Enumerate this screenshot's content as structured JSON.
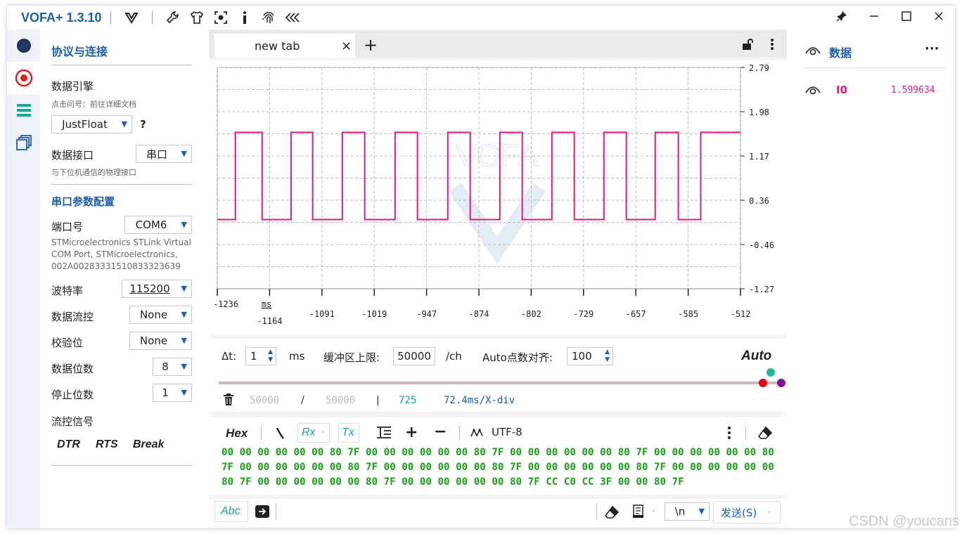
{
  "app": {
    "title": "VOFA+ 1.3.10"
  },
  "left": {
    "section1": "协议与连接",
    "engine_label": "数据引擎",
    "engine_hint": "点击问号：前往详细文档",
    "engine_value": "JustFloat",
    "help": "?",
    "iface_label": "数据接口",
    "iface_value": "串口",
    "iface_hint": "与下位机通信的物理接口",
    "section2": "串口参数配置",
    "port_label": "端口号",
    "port_value": "COM6",
    "port_desc": "STMicroelectronics STLink Virtual COM Port, STMicroelectronics, 002A00283331510833323639",
    "baud_label": "波特率",
    "baud_value": "115200",
    "flow_label": "数据流控",
    "flow_value": "None",
    "parity_label": "校验位",
    "parity_value": "None",
    "databits_label": "数据位数",
    "databits_value": "8",
    "stopbits_label": "停止位数",
    "stopbits_value": "1",
    "signal_label": "流控信号",
    "dtr": "DTR",
    "rts": "RTS",
    "brk": "Break"
  },
  "tab": {
    "label": "new tab",
    "close": "×",
    "add": "+"
  },
  "chart_data": {
    "type": "line",
    "y_ticks": [
      "2.79",
      "1.98",
      "1.17",
      "0.36",
      "-0.46",
      "-1.27"
    ],
    "x_ticks": [
      "-1236",
      "-1164",
      "-1091",
      "-1019",
      "-947",
      "-874",
      "-802",
      "-729",
      "-657",
      "-585",
      "-512"
    ],
    "x_unit": "ms",
    "ylim": [
      -1.27,
      2.79
    ],
    "xlim": [
      -1236,
      -512
    ],
    "series": [
      {
        "name": "I0",
        "color": "#e0177f",
        "low": 0,
        "high": 1.6,
        "edges": [
          -1236,
          -1211,
          -1174,
          -1134,
          -1104,
          -1063,
          -1032,
          -990,
          -959,
          -917,
          -886,
          -845,
          -814,
          -773,
          -742,
          -701,
          -670,
          -630,
          -598,
          -567,
          -512
        ]
      }
    ]
  },
  "control": {
    "dt_label": "Δt:",
    "dt_value": "1",
    "dt_unit": "ms",
    "buf_label": "缓冲区上限:",
    "buf_value": "50000",
    "buf_unit": "/ch",
    "auto_label": "Auto点数对齐:",
    "auto_value": "100",
    "auto_btn": "Auto",
    "stat_a": "50000",
    "stat_slash": "/",
    "stat_b": "50000",
    "stat_bar": "|",
    "stat_c": "725",
    "stat_d": "72.4ms/X-div"
  },
  "hexbar": {
    "hex": "Hex",
    "rx": "Rx",
    "tx": "Tx",
    "encoding": "UTF-8",
    "data": "00 00 00 00 00 00 80 7F 00 00 00 00 00 00 80 7F 00 00 00 00 00 00 80 7F 00 00 00 00 00 00 80 7F 00 00 00 00 00 00 80 7F 00 00 00 00 00 00 80 7F 00 00 00 00 00 00 80 7F 00 00 00 00 00 00 80 7F 00 00 00 00 00 00 80 7F 00 00 00 00 00 00 80 7F CC C0 CC 3F 00 00 80 7F"
  },
  "send": {
    "abc": "Abc",
    "newline": "\\n",
    "send_btn": "发送(S)"
  },
  "right": {
    "title": "数据",
    "more": "···",
    "channel_name": "I0",
    "channel_value": "1.599634"
  },
  "watermark": "CSDN @youcans"
}
